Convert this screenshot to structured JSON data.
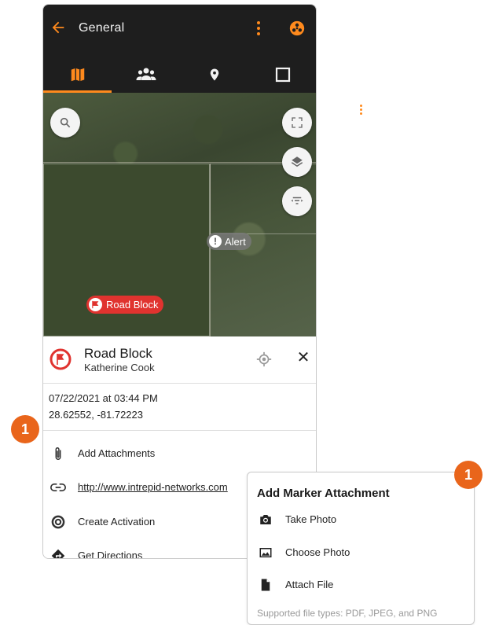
{
  "appbar": {
    "title": "General",
    "icons": {
      "back": "arrow-left-icon",
      "menu": "more-vertical-icon",
      "profile": "biohazard-icon"
    }
  },
  "tabs": [
    {
      "name": "map",
      "icon": "map-icon",
      "active": true
    },
    {
      "name": "teams",
      "icon": "people-icon",
      "active": false
    },
    {
      "name": "places",
      "icon": "location-pin-icon",
      "active": false
    },
    {
      "name": "areas",
      "icon": "square-outline-icon",
      "active": false
    }
  ],
  "map": {
    "markers": [
      {
        "label": "Alert",
        "icon": "exclamation-icon"
      },
      {
        "label": "Road Block",
        "icon": "road-block-icon"
      }
    ],
    "controls": [
      "search-icon",
      "fullscreen-icon",
      "layers-icon",
      "filter-icon"
    ]
  },
  "marker": {
    "title": "Road Block",
    "author": "Katherine Cook",
    "timestamp": "07/22/2021 at 03:44 PM",
    "coordinates": "28.62552, -81.72223"
  },
  "actions": [
    {
      "label": "Add Attachments",
      "icon": "paperclip-icon"
    },
    {
      "label": "http://www.intrepid-networks.com",
      "icon": "link-icon"
    },
    {
      "label": "Create Activation",
      "icon": "target-icon"
    },
    {
      "label": "Get Directions",
      "icon": "directions-icon"
    }
  ],
  "badges": {
    "step": "1"
  },
  "popup": {
    "title": "Add Marker Attachment",
    "options": [
      {
        "label": "Take Photo",
        "icon": "camera-icon"
      },
      {
        "label": "Choose Photo",
        "icon": "image-icon"
      },
      {
        "label": "Attach File",
        "icon": "file-icon"
      }
    ],
    "footer": "Supported file types: PDF, JPEG, and PNG"
  },
  "colors": {
    "accent": "#ff8a1d",
    "badge": "#e9651b",
    "roadblock": "#e0332f",
    "appbar": "#1e1e1e"
  }
}
